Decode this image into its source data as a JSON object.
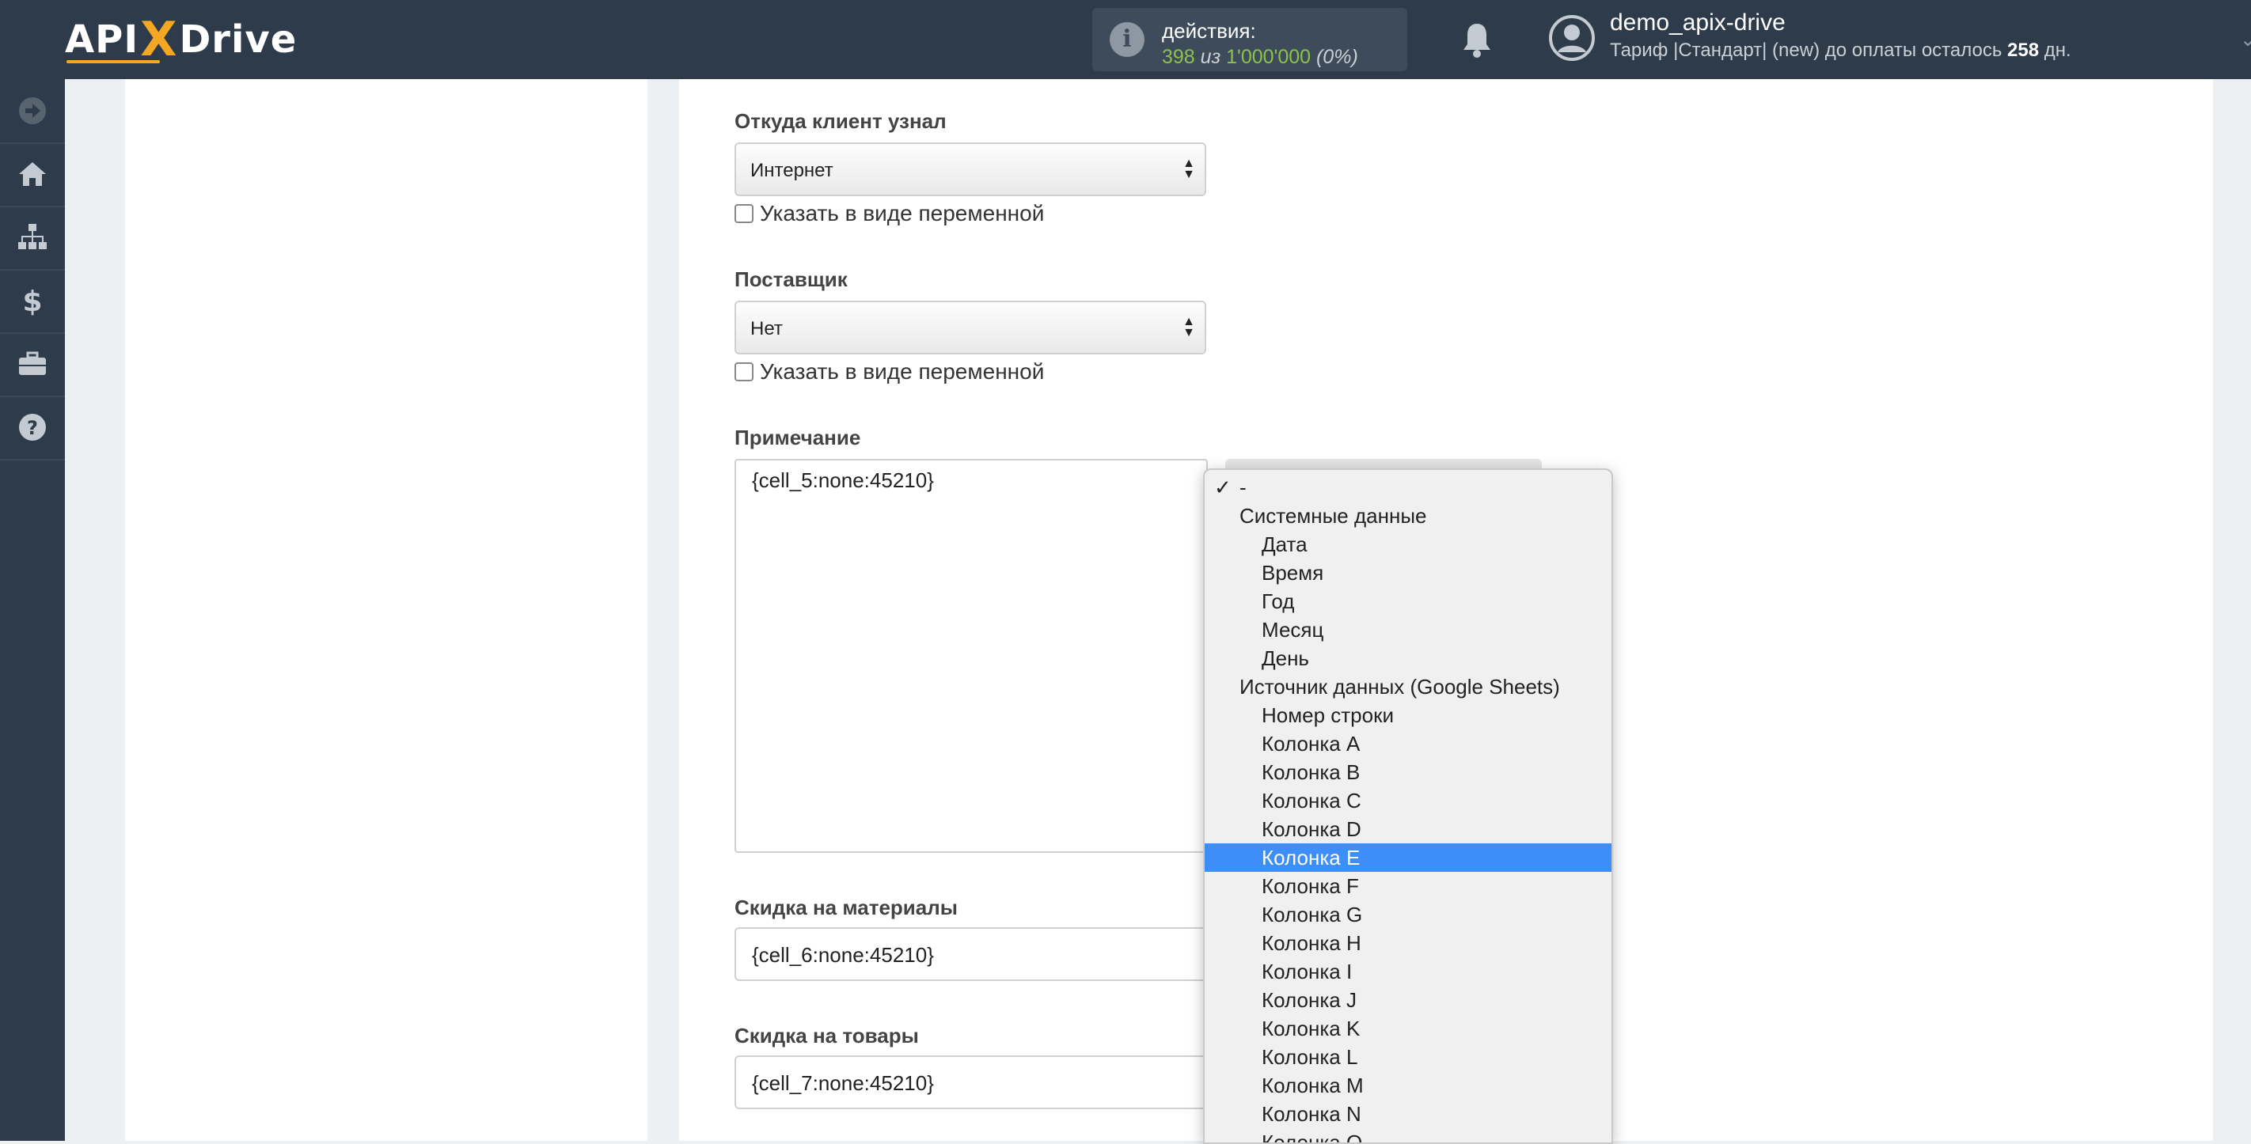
{
  "header": {
    "logo": {
      "left": "API",
      "x": "X",
      "right": "Drive"
    },
    "actions_label": "действия:",
    "actions_used": "398",
    "actions_of": "из",
    "actions_total": "1'000'000",
    "actions_percent": "(0%)",
    "username": "demo_apix-drive",
    "tariff_text": "Тариф |Стандарт| (new) до оплаты осталось",
    "tariff_days": "258",
    "tariff_suffix": "дн."
  },
  "sidebar": {
    "items": [
      {
        "icon": "arrow-right-circle-icon"
      },
      {
        "icon": "home-icon"
      },
      {
        "icon": "sitemap-icon"
      },
      {
        "icon": "dollar-icon"
      },
      {
        "icon": "briefcase-icon"
      },
      {
        "icon": "help-icon"
      }
    ]
  },
  "form": {
    "source_label": "Откуда клиент узнал",
    "source_value": "Интернет",
    "supplier_label": "Поставщик",
    "supplier_value": "Нет",
    "var_checkbox_label": "Указать в виде переменной",
    "note_label": "Примечание",
    "note_value": "{cell_5:none:45210}",
    "materials_label": "Скидка на материалы",
    "materials_value": "{cell_6:none:45210}",
    "goods_label": "Скидка на товары",
    "goods_value": "{cell_7:none:45210}"
  },
  "dropdown": {
    "options": [
      {
        "label": "-",
        "type": "grp",
        "checked": true
      },
      {
        "label": "Системные данные",
        "type": "grp"
      },
      {
        "label": "Дата",
        "type": "sub"
      },
      {
        "label": "Время",
        "type": "sub"
      },
      {
        "label": "Год",
        "type": "sub"
      },
      {
        "label": "Месяц",
        "type": "sub"
      },
      {
        "label": "День",
        "type": "sub"
      },
      {
        "label": "Источник данных (Google Sheets)",
        "type": "grp"
      },
      {
        "label": "Номер строки",
        "type": "sub"
      },
      {
        "label": "Колонка A",
        "type": "sub"
      },
      {
        "label": "Колонка B",
        "type": "sub"
      },
      {
        "label": "Колонка C",
        "type": "sub"
      },
      {
        "label": "Колонка D",
        "type": "sub"
      },
      {
        "label": "Колонка E",
        "type": "sub",
        "selected": true
      },
      {
        "label": "Колонка F",
        "type": "sub"
      },
      {
        "label": "Колонка G",
        "type": "sub"
      },
      {
        "label": "Колонка H",
        "type": "sub"
      },
      {
        "label": "Колонка I",
        "type": "sub"
      },
      {
        "label": "Колонка J",
        "type": "sub"
      },
      {
        "label": "Колонка K",
        "type": "sub"
      },
      {
        "label": "Колонка L",
        "type": "sub"
      },
      {
        "label": "Колонка M",
        "type": "sub"
      },
      {
        "label": "Колонка N",
        "type": "sub"
      },
      {
        "label": "Колонка O",
        "type": "sub"
      }
    ]
  },
  "colors": {
    "topbar": "#2e3b4a",
    "accent_orange": "#f5a623",
    "actions_green": "#8bc34a",
    "selection_blue": "#3d8ef8"
  }
}
